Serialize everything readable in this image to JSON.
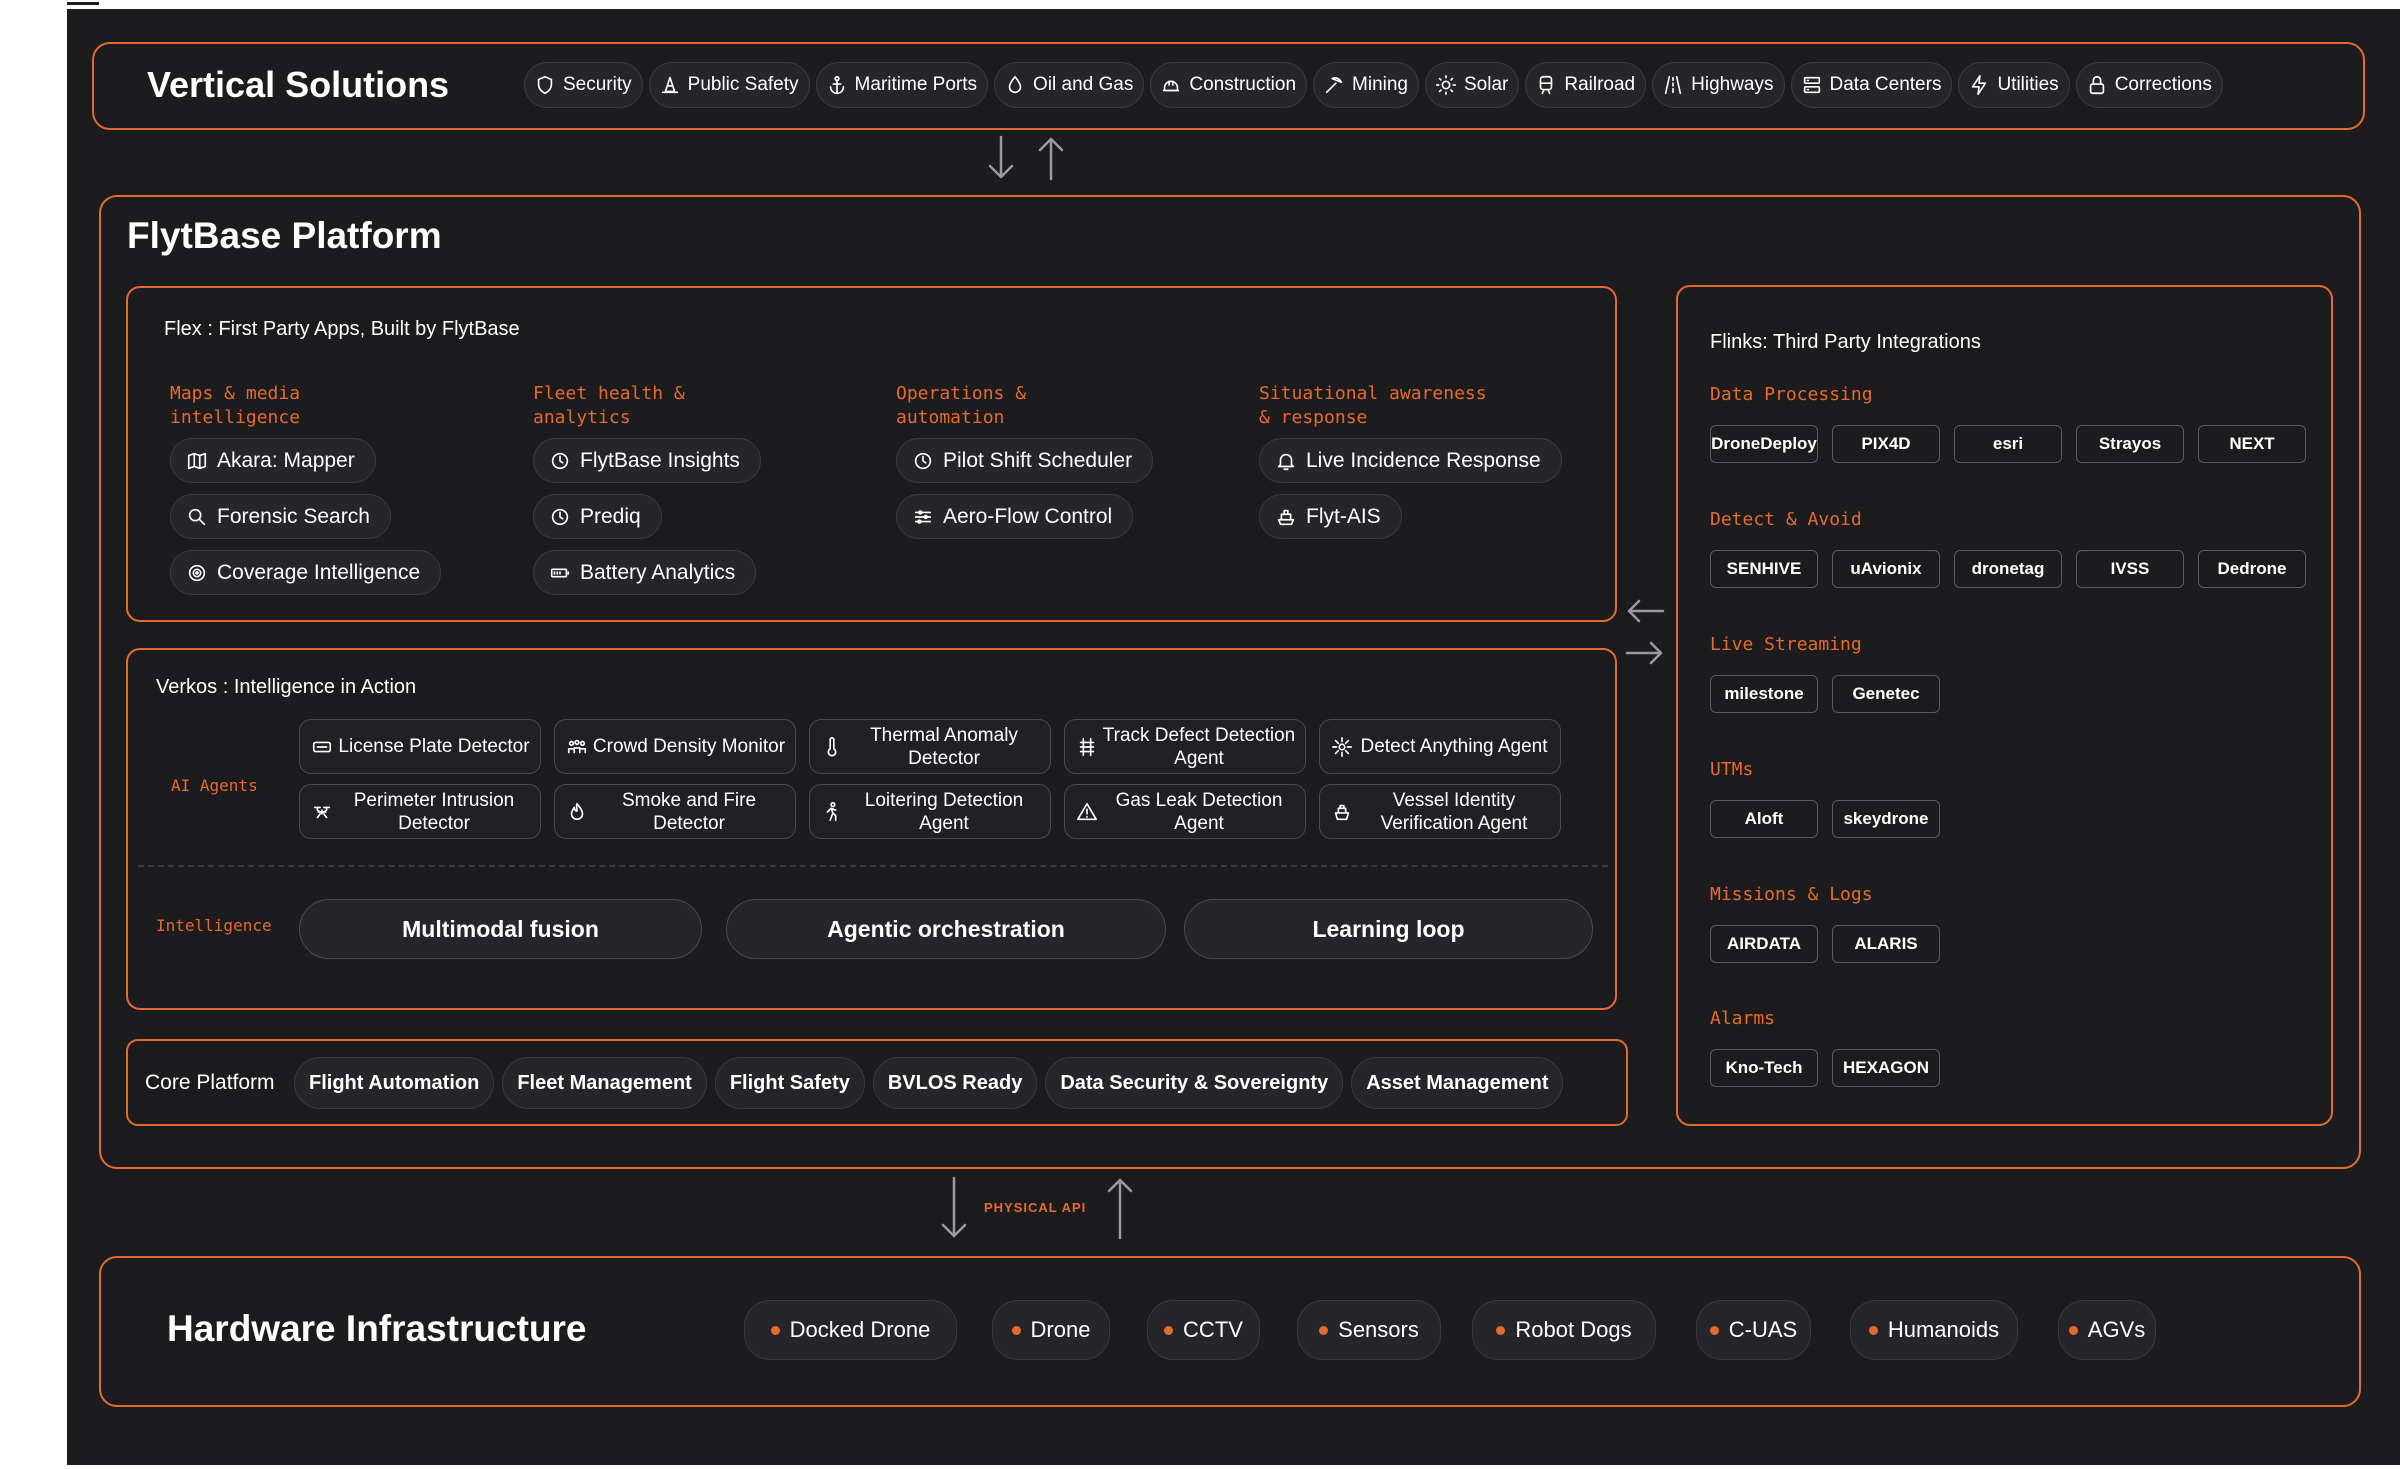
{
  "colors": {
    "accent": "#e56a2e",
    "background": "#1c1c1e",
    "chip": "#26262a"
  },
  "vertical_solutions": {
    "title": "Vertical Solutions",
    "items": [
      {
        "label": "Security",
        "icon": "shield-icon"
      },
      {
        "label": "Public Safety",
        "icon": "cone-icon"
      },
      {
        "label": "Maritime Ports",
        "icon": "anchor-icon"
      },
      {
        "label": "Oil and Gas",
        "icon": "drop-icon"
      },
      {
        "label": "Construction",
        "icon": "hard-hat-icon"
      },
      {
        "label": "Mining",
        "icon": "pickaxe-icon"
      },
      {
        "label": "Solar",
        "icon": "sun-icon"
      },
      {
        "label": "Railroad",
        "icon": "train-icon"
      },
      {
        "label": "Highways",
        "icon": "road-icon"
      },
      {
        "label": "Data Centers",
        "icon": "server-icon"
      },
      {
        "label": "Utilities",
        "icon": "bolt-icon"
      },
      {
        "label": "Corrections",
        "icon": "lock-icon"
      }
    ]
  },
  "platform": {
    "title": "FlytBase Platform",
    "flex": {
      "title": "Flex : First Party Apps, Built by FlytBase",
      "groups": [
        {
          "title": "Maps & media intelligence",
          "apps": [
            {
              "label": "Akara: Mapper",
              "icon": "map-icon"
            },
            {
              "label": "Forensic Search",
              "icon": "search-icon"
            },
            {
              "label": "Coverage Intelligence",
              "icon": "target-icon"
            }
          ]
        },
        {
          "title": "Fleet health & analytics",
          "apps": [
            {
              "label": "FlytBase Insights",
              "icon": "clock-icon"
            },
            {
              "label": "Prediq",
              "icon": "clock-icon"
            },
            {
              "label": "Battery Analytics",
              "icon": "battery-icon"
            }
          ]
        },
        {
          "title": "Operations & automation",
          "apps": [
            {
              "label": "Pilot Shift Scheduler",
              "icon": "clock-icon"
            },
            {
              "label": "Aero-Flow Control",
              "icon": "sliders-icon"
            }
          ]
        },
        {
          "title": "Situational awareness & response",
          "apps": [
            {
              "label": "Live Incidence Response",
              "icon": "bell-icon"
            },
            {
              "label": "Flyt-AIS",
              "icon": "ship-icon"
            }
          ]
        }
      ]
    },
    "verkos": {
      "title": "Verkos : Intelligence in Action",
      "agents_label": "AI Agents",
      "agents": [
        {
          "label": "License Plate Detector",
          "icon": "plate-icon"
        },
        {
          "label": "Crowd Density Monitor",
          "icon": "crowd-icon"
        },
        {
          "label": "Thermal Anomaly Detector",
          "icon": "thermometer-icon"
        },
        {
          "label": "Track Defect Detection Agent",
          "icon": "track-icon"
        },
        {
          "label": "Detect Anything Agent",
          "icon": "spark-icon"
        },
        {
          "label": "Perimeter Intrusion Detector",
          "icon": "drone-icon"
        },
        {
          "label": "Smoke and Fire Detector",
          "icon": "flame-icon"
        },
        {
          "label": "Loitering Detection Agent",
          "icon": "walker-icon"
        },
        {
          "label": "Gas Leak Detection Agent",
          "icon": "warning-icon"
        },
        {
          "label": "Vessel Identity Verification Agent",
          "icon": "vessel-icon"
        }
      ],
      "intelligence_label": "Intelligence",
      "intelligence": [
        "Multimodal fusion",
        "Agentic orchestration",
        "Learning loop"
      ]
    },
    "core": {
      "title": "Core Platform",
      "items": [
        "Flight Automation",
        "Fleet Management",
        "Flight Safety",
        "BVLOS Ready",
        "Data Security & Sovereignty",
        "Asset Management"
      ]
    },
    "flinks": {
      "title": "Flinks: Third Party Integrations",
      "categories": [
        {
          "title": "Data Processing",
          "logos": [
            "DroneDeploy",
            "PIX4D",
            "esri",
            "Strayos",
            "NEXT"
          ]
        },
        {
          "title": "Detect & Avoid",
          "logos": [
            "SENHIVE",
            "uAvionix",
            "dronetag",
            "IVSS",
            "Dedrone"
          ]
        },
        {
          "title": "Live Streaming",
          "logos": [
            "milestone",
            "Genetec"
          ]
        },
        {
          "title": "UTMs",
          "logos": [
            "Aloft",
            "skeydrone"
          ]
        },
        {
          "title": "Missions & Logs",
          "logos": [
            "AIRDATA",
            "ALARIS"
          ]
        },
        {
          "title": "Alarms",
          "logos": [
            "Kno-Tech",
            "HEXAGON"
          ]
        }
      ]
    }
  },
  "api_label": "PHYSICAL API",
  "hardware": {
    "title": "Hardware Infrastructure",
    "items": [
      "Docked Drone",
      "Drone",
      "CCTV",
      "Sensors",
      "Robot Dogs",
      "C-UAS",
      "Humanoids",
      "AGVs"
    ]
  }
}
